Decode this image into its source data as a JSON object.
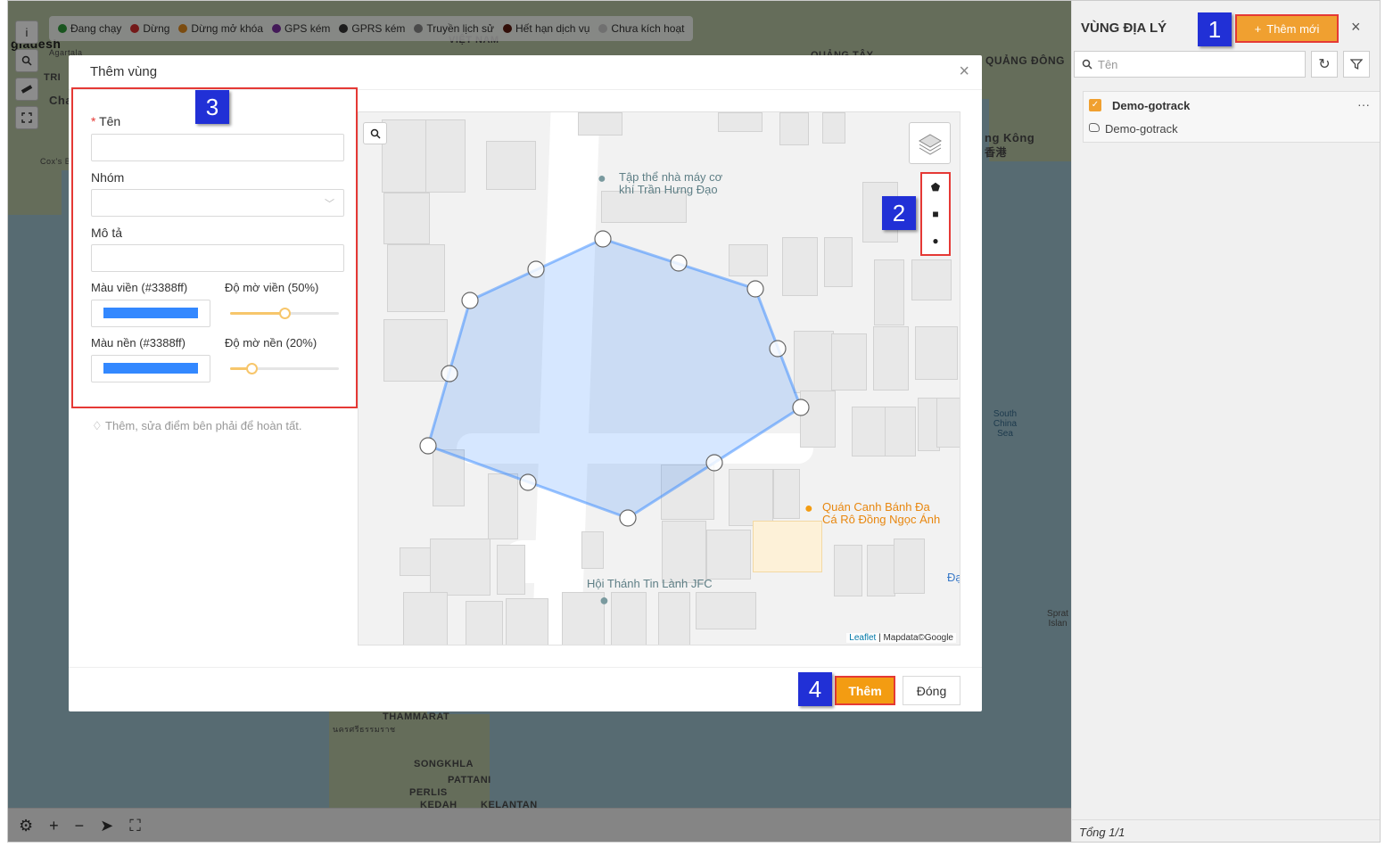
{
  "legend": [
    {
      "label": "Đang chạy",
      "color": "#2e9c3a"
    },
    {
      "label": "Dừng",
      "color": "#d32f2f"
    },
    {
      "label": "Dừng mở khóa",
      "color": "#e08a1e"
    },
    {
      "label": "GPS kém",
      "color": "#7b2fa0"
    },
    {
      "label": "GPRS kém",
      "color": "#333333"
    },
    {
      "label": "Truyền lịch sử",
      "color": "#888888"
    },
    {
      "label": "Hết hạn dịch vụ",
      "color": "#5a1a10"
    },
    {
      "label": "Chưa kích hoạt",
      "color": "#cccccc"
    }
  ],
  "map_labels": {
    "bangladesh": "gladesh",
    "agartala": "Agartala",
    "tri": "TRI",
    "cha": "Cha",
    "coxs": "Cox's B",
    "vietnam": "VIỆT NAM",
    "quangtay": "QUẢNG TÂY",
    "quangdong": "QUẢNG ĐÔNG",
    "hongkong": "ng Kông",
    "hongkong_cn": "香港",
    "south_china_sea": "South China Sea",
    "spratly": "Sprat Islan",
    "thammarat": "THAMMARAT",
    "thai_nakhon": "นครศรีธรรมราช",
    "songkhla": "SONGKHLA",
    "pattani": "PATTANI",
    "perlis": "PERLIS",
    "kedah": "KEDAH",
    "kelantan": "KELANTAN"
  },
  "right_panel": {
    "title": "VÙNG ĐỊA LÝ",
    "add_button": "Thêm mới",
    "search_placeholder": "Tên",
    "group_name": "Demo-gotrack",
    "zone_name": "Demo-gotrack",
    "footer": "Tổng 1/1"
  },
  "modal": {
    "title": "Thêm vùng",
    "fields": {
      "name_label": "Tên",
      "group_label": "Nhóm",
      "desc_label": "Mô tả",
      "border_color_label": "Màu viền (#3388ff)",
      "border_opacity_label": "Độ mờ viền (50%)",
      "fill_color_label": "Màu nền (#3388ff)",
      "fill_opacity_label": "Độ mờ nền (20%)",
      "border_color": "#3388ff",
      "fill_color": "#3388ff",
      "border_opacity": 0.5,
      "fill_opacity": 0.2
    },
    "hint": "Thêm, sửa điểm bên phải để hoàn tất.",
    "map": {
      "poi1_line1": "Tập thể nhà máy cơ",
      "poi1_line2": "khí Trần Hưng Đạo",
      "poi2_line1": "Quán Canh Bánh Đa",
      "poi2_line2": "Cá Rô Đồng Ngọc Ánh",
      "poi3": "Hội Thánh Tin Lành JFC",
      "edge_label": "Đạ",
      "attribution_link": "Leaflet",
      "attribution_text": " | Mapdata©Google"
    },
    "submit": "Thêm",
    "close": "Đóng"
  },
  "badges": [
    "1",
    "2",
    "3",
    "4"
  ]
}
